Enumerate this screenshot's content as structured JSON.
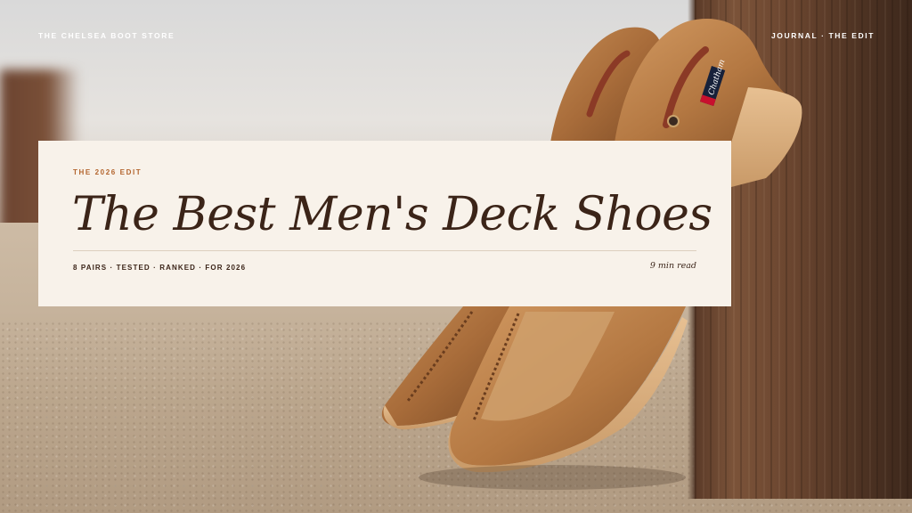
{
  "header": {
    "brand": "THE CHELSEA BOOT STORE",
    "nav_label": "JOURNAL · THE EDIT"
  },
  "article": {
    "kicker": "THE 2026 EDIT",
    "title": "The Best Men's Deck Shoes",
    "meta": "8 PAIRS · TESTED · RANKED · FOR 2026",
    "read_time": "9 min read"
  },
  "hero_image": {
    "brand_tag": "Chatham"
  },
  "colors": {
    "card_background": "#f8f2ea",
    "kicker_accent": "#b3652e",
    "title_text": "#3b2418",
    "header_text": "#ffffff"
  }
}
